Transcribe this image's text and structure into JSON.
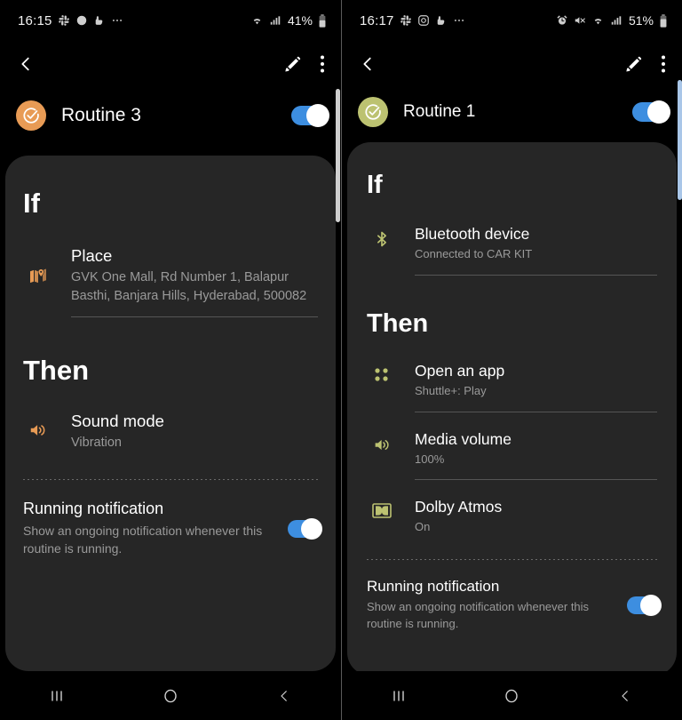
{
  "colors": {
    "background": "#000000",
    "card": "#262626",
    "toggle_on": "#3d8ee0",
    "toggle_knob": "#ffffff",
    "accent_left": "#e89b55",
    "accent_right": "#bcc271",
    "title_text": "#ffffff",
    "sub_text": "#9a9a9a",
    "divider": "#555555",
    "scrollbar_left": "#cfcfcf",
    "scrollbar_right": "#a9c6e8"
  },
  "screens": [
    {
      "id": "left",
      "status_bar": {
        "time": "16:15",
        "left_icons": [
          "slack-icon",
          "threads-icon",
          "app-icon",
          "more-dots-icon"
        ],
        "right_icons": [
          "wifi-icon",
          "signal-icon",
          "battery-icon"
        ],
        "battery_percent": "41%"
      },
      "app_bar": {
        "back_icon": "back-chevron-icon",
        "edit_icon": "pencil-edit-icon",
        "overflow_icon": "more-vertical-icon"
      },
      "routine": {
        "badge_icon": "routine-check-icon",
        "badge_color": "#e89b55",
        "name": "Routine 3",
        "enabled": true
      },
      "if_section": {
        "heading": "If",
        "entries": [
          {
            "icon": "place-map-pin-icon",
            "title": "Place",
            "subtitle": "GVK One Mall, Rd Number 1, Balapur Basthi, Banjara Hills, Hyderabad,  500082",
            "divider": true
          }
        ]
      },
      "then_section": {
        "heading": "Then",
        "entries": [
          {
            "icon": "sound-speaker-icon",
            "title": "Sound mode",
            "subtitle": "Vibration",
            "divider": false
          }
        ]
      },
      "running_notification": {
        "title": "Running notification",
        "subtitle": "Show an ongoing notification whenever this routine is running.",
        "enabled": true
      },
      "nav_bar": {
        "recents_icon": "recents-icon",
        "home_icon": "home-circle-icon",
        "back_icon": "back-chevron-icon"
      }
    },
    {
      "id": "right",
      "status_bar": {
        "time": "16:17",
        "left_icons": [
          "slack-icon",
          "instagram-icon",
          "app-icon",
          "more-dots-icon"
        ],
        "right_icons": [
          "alarm-icon",
          "mute-icon",
          "wifi-icon",
          "signal-icon",
          "battery-icon"
        ],
        "battery_percent": "51%"
      },
      "app_bar": {
        "back_icon": "back-chevron-icon",
        "edit_icon": "pencil-edit-icon",
        "overflow_icon": "more-vertical-icon"
      },
      "routine": {
        "badge_icon": "routine-check-icon",
        "badge_color": "#bcc271",
        "name": "Routine 1",
        "enabled": true
      },
      "if_section": {
        "heading": "If",
        "entries": [
          {
            "icon": "bluetooth-icon",
            "title": "Bluetooth device",
            "subtitle": "Connected to CAR KIT",
            "divider": true
          }
        ]
      },
      "then_section": {
        "heading": "Then",
        "entries": [
          {
            "icon": "app-grid-icon",
            "title": "Open an app",
            "subtitle": "Shuttle+: Play",
            "divider": true
          },
          {
            "icon": "media-volume-icon",
            "title": "Media volume",
            "subtitle": "100%",
            "divider": true
          },
          {
            "icon": "dolby-atmos-icon",
            "title": "Dolby Atmos",
            "subtitle": "On",
            "divider": false
          }
        ]
      },
      "running_notification": {
        "title": "Running notification",
        "subtitle": "Show an ongoing notification whenever this routine is running.",
        "enabled": true
      },
      "nav_bar": {
        "recents_icon": "recents-icon",
        "home_icon": "home-circle-icon",
        "back_icon": "back-chevron-icon"
      }
    }
  ]
}
